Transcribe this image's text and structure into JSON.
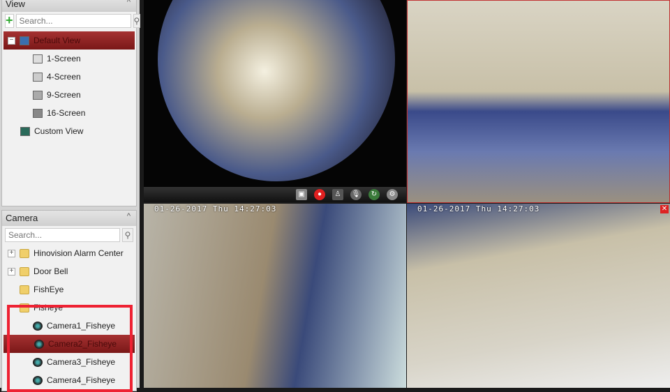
{
  "view_panel": {
    "title": "View",
    "search_placeholder": "Search...",
    "items": [
      {
        "label": "Default View"
      },
      {
        "label": "1-Screen"
      },
      {
        "label": "4-Screen"
      },
      {
        "label": "9-Screen"
      },
      {
        "label": "16-Screen"
      },
      {
        "label": "Custom View"
      }
    ]
  },
  "camera_panel": {
    "title": "Camera",
    "search_placeholder": "Search...",
    "items": [
      {
        "label": "Hinovision Alarm Center"
      },
      {
        "label": "Door Bell"
      },
      {
        "label": "FishEye"
      },
      {
        "label": "Fisheye"
      },
      {
        "label": "Camera1_Fisheye"
      },
      {
        "label": "Camera2_Fisheye"
      },
      {
        "label": "Camera3_Fisheye"
      },
      {
        "label": "Camera4_Fisheye"
      }
    ]
  },
  "video": {
    "timestamp_bl": "01-26-2017 Thu 14:27:03",
    "timestamp_br": "01-26-2017 Thu 14:27:03",
    "toolbar_icons": [
      "capture-icon",
      "record-icon",
      "ptz-icon",
      "microphone-icon",
      "refresh-icon",
      "settings-icon"
    ]
  },
  "colors": {
    "selected": "#8b2020",
    "highlight_box": "#e22233",
    "active_border": "#c03030"
  }
}
